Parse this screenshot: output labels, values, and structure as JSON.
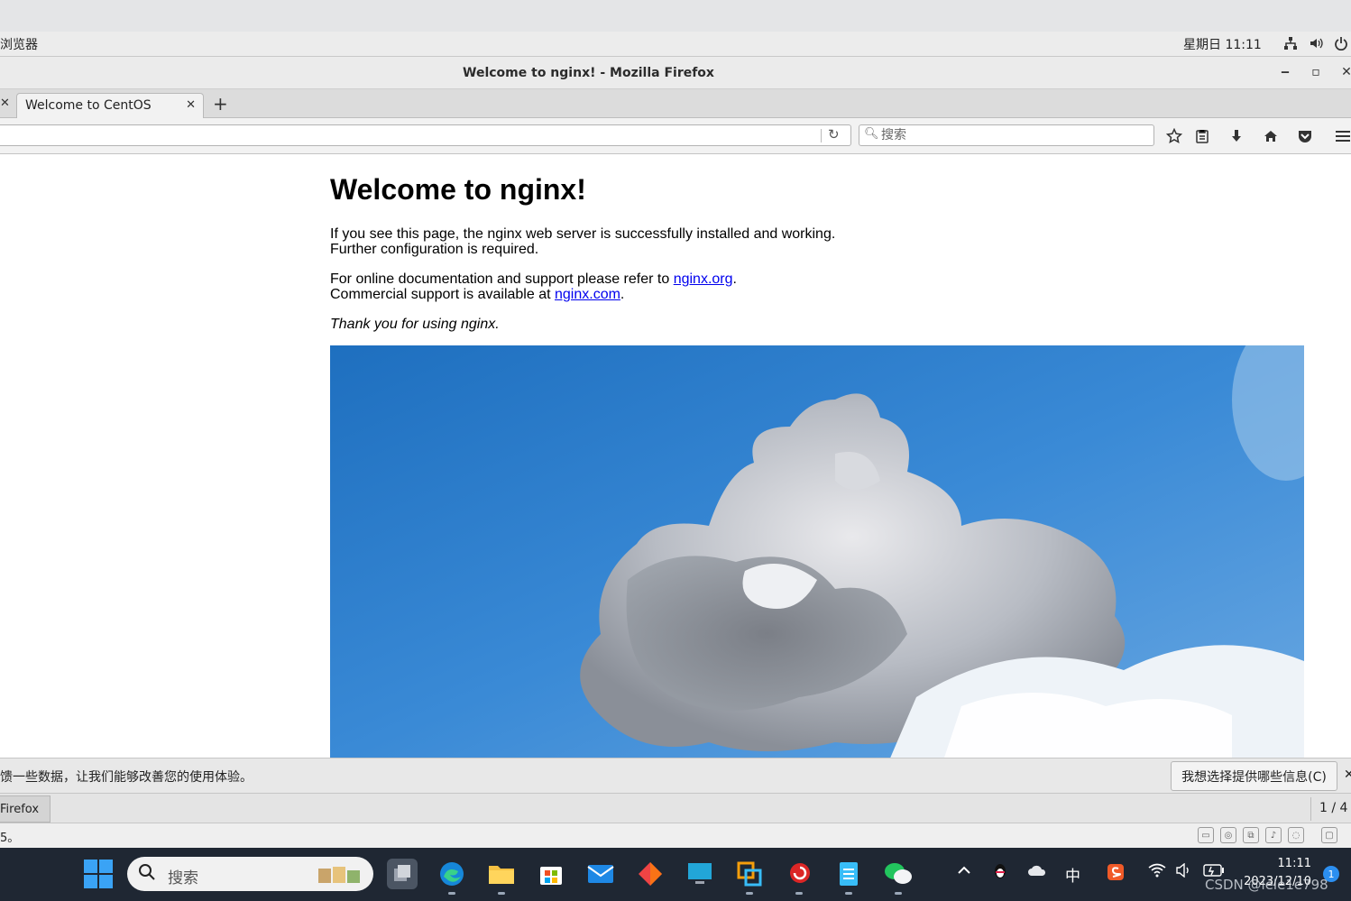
{
  "gnome_top": {
    "apps_label": "浏览器",
    "clock": "星期日 11:11"
  },
  "window": {
    "title": "Welcome to nginx! - Mozilla Firefox"
  },
  "tabs": [
    {
      "label": "Welcome to CentOS"
    }
  ],
  "toolbar": {
    "search_placeholder": "搜索"
  },
  "page": {
    "heading": "Welcome to nginx!",
    "para1_line1": "If you see this page, the nginx web server is successfully installed and working.",
    "para1_line2": "Further configuration is required.",
    "para2_prefix": "For online documentation and support please refer to ",
    "link_org": "nginx.org",
    "para2_suffix": ".",
    "para3_prefix": "Commercial support is available at ",
    "link_com": "nginx.com",
    "para3_suffix": ".",
    "thanks": "Thank you for using nginx."
  },
  "notification": {
    "message": "馈一些数据，让我们能够改善您的使用体验。",
    "button_label": "我想选择提供哪些信息(C)"
  },
  "tasklist": {
    "task_label": "Firefox",
    "workspace": "1 / 4"
  },
  "vm_status": {
    "text": "5。"
  },
  "win_taskbar": {
    "search_label": "搜索",
    "ime": "中",
    "time": "11:11",
    "date": "2023/12/10",
    "badge": "1",
    "watermark": "CSDN @lele1e798"
  },
  "colors": {
    "link": "#0000ee",
    "taskbar_bg": "#1f2733",
    "sky": "#3c8ad6"
  }
}
